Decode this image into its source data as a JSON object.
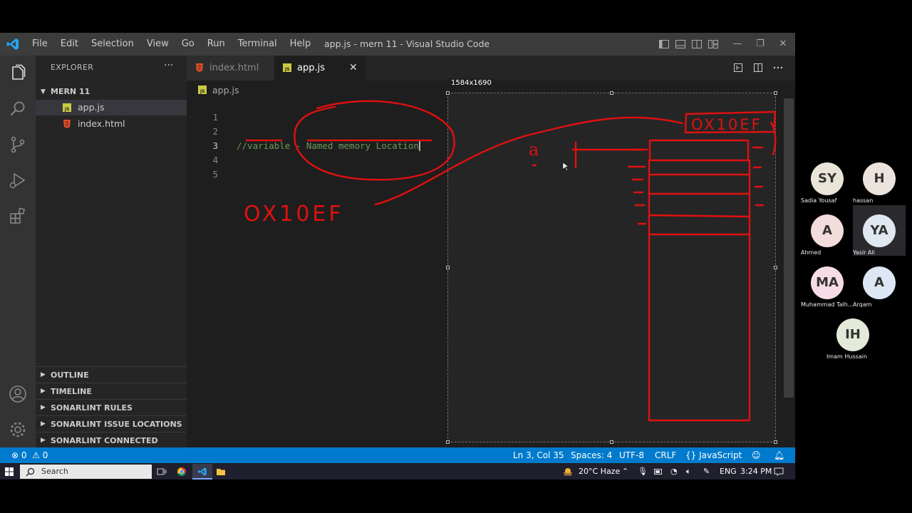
{
  "window": {
    "title": "app.js - mern 11 - Visual Studio Code",
    "menu": [
      "File",
      "Edit",
      "Selection",
      "View",
      "Go",
      "Run",
      "Terminal",
      "Help"
    ]
  },
  "sidebar": {
    "header": "EXPLORER",
    "more": "···",
    "folder": "MERN 11",
    "files": [
      {
        "name": "app.js",
        "type": "js",
        "selected": true
      },
      {
        "name": "index.html",
        "type": "html",
        "selected": false
      }
    ],
    "panels": [
      "OUTLINE",
      "TIMELINE",
      "SONARLINT RULES",
      "SONARLINT ISSUE LOCATIONS",
      "SONARLINT CONNECTED MODE"
    ]
  },
  "editor": {
    "tabs": [
      {
        "name": "index.html",
        "type": "html",
        "active": false
      },
      {
        "name": "app.js",
        "type": "js",
        "active": true,
        "close": "✕"
      }
    ],
    "breadcrumb": "app.js",
    "line_numbers": [
      "1",
      "2",
      "3",
      "4",
      "5"
    ],
    "current_line": "3",
    "code_line_3": "//variable - Named memory Location",
    "image_size": "1584x1690"
  },
  "annotations": {
    "address_label": "OX10EF",
    "address_box": "OX10EF",
    "var_name": "a",
    "ink_color": "#e01010"
  },
  "statusbar": {
    "errors": "0",
    "warnings": "0",
    "position": "Ln 3, Col 35",
    "spaces": "Spaces: 4",
    "encoding": "UTF-8",
    "eol": "CRLF",
    "language_icon": "{}",
    "language": "JavaScript"
  },
  "taskbar": {
    "search": "Search",
    "weather": "20°C  Haze",
    "lang": "ENG",
    "time": "3:24 PM"
  },
  "participants": [
    {
      "initials": "SY",
      "name": "Sadia Yousaf",
      "color": "#e9e4d8"
    },
    {
      "initials": "H",
      "name": "hassan",
      "color": "#ece4dc"
    },
    {
      "initials": "A",
      "name": "Ahmed",
      "color": "#f3dcdc"
    },
    {
      "initials": "YA",
      "name": "Yasir Ali",
      "color": "#dfe8f1"
    },
    {
      "initials": "MA",
      "name": "Muhammad Talh...",
      "color": "#f5dce6"
    },
    {
      "initials": "A",
      "name": "Arqam",
      "color": "#dde6f3"
    },
    {
      "initials": "IH",
      "name": "Imam Hussain",
      "color": "#e4ead9"
    }
  ],
  "colors": {
    "accent": "#007acc",
    "js_icon": "#cbcb41",
    "html_icon": "#e44d26"
  }
}
